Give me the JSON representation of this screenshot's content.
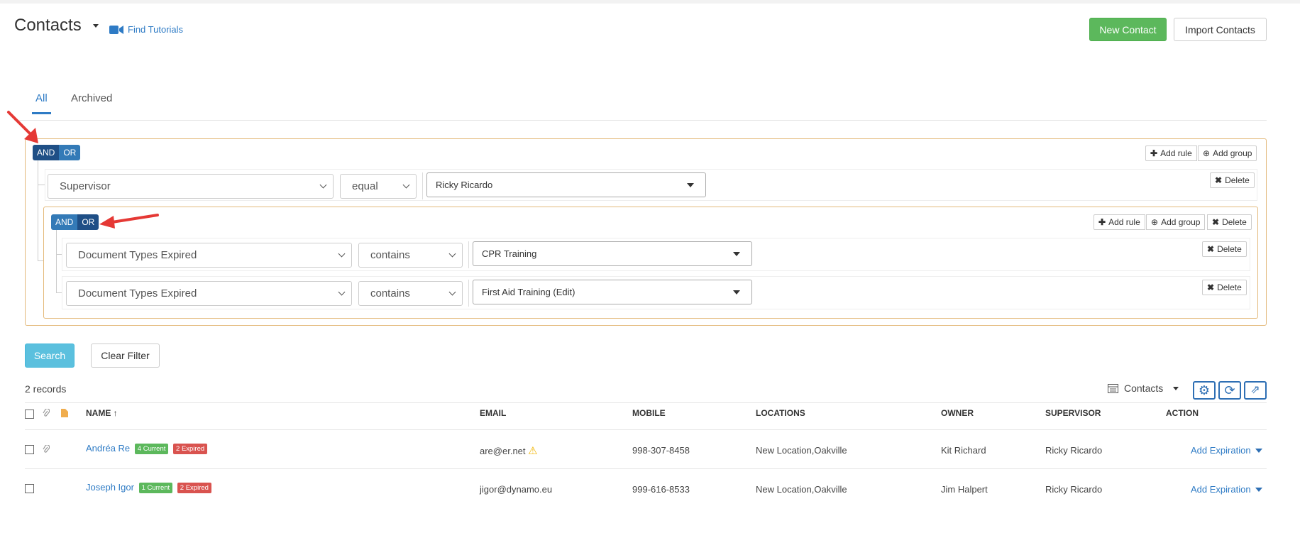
{
  "header": {
    "title": "Contacts",
    "tutorials_label": "Find Tutorials",
    "new_contact_label": "New Contact",
    "import_contacts_label": "Import Contacts"
  },
  "tabs": [
    {
      "label": "All",
      "active": true
    },
    {
      "label": "Archived",
      "active": false
    }
  ],
  "filter": {
    "and_label": "AND",
    "or_label": "OR",
    "add_rule_label": "Add rule",
    "add_group_label": "Add group",
    "delete_label": "Delete",
    "root_rule": {
      "field": "Supervisor",
      "operator": "equal",
      "value": "Ricky Ricardo"
    },
    "sub_rules": [
      {
        "field": "Document Types Expired",
        "operator": "contains",
        "value": "CPR Training"
      },
      {
        "field": "Document Types Expired",
        "operator": "contains",
        "value": "First Aid Training (Edit)"
      }
    ]
  },
  "actions": {
    "search_label": "Search",
    "clear_filter_label": "Clear Filter"
  },
  "records_count": "2 records",
  "view_selector": "Contacts",
  "table": {
    "headers": {
      "name": "NAME ↑",
      "email": "EMAIL",
      "mobile": "MOBILE",
      "locations": "LOCATIONS",
      "owner": "OWNER",
      "supervisor": "SUPERVISOR",
      "action": "ACTION"
    },
    "rows": [
      {
        "name": "Andréa Re",
        "current": "4 Current",
        "expired": "2 Expired",
        "email": "are@er.net",
        "mobile": "998-307-8458",
        "locations": "New Location,Oakville",
        "owner": "Kit Richard",
        "supervisor": "Ricky Ricardo",
        "action": "Add Expiration"
      },
      {
        "name": "Joseph Igor",
        "current": "1 Current",
        "expired": "2 Expired",
        "email": "jigor@dynamo.eu",
        "mobile": "999-616-8533",
        "locations": "New Location,Oakville",
        "owner": "Jim Halpert",
        "supervisor": "Ricky Ricardo",
        "action": "Add Expiration"
      }
    ]
  },
  "colors": {
    "accent": "#337ab7",
    "and_active": "#1f4f86",
    "success": "#5cb85c",
    "danger": "#d9534f",
    "group_border": "#e3b97a",
    "annotation_arrow": "#e53935"
  }
}
